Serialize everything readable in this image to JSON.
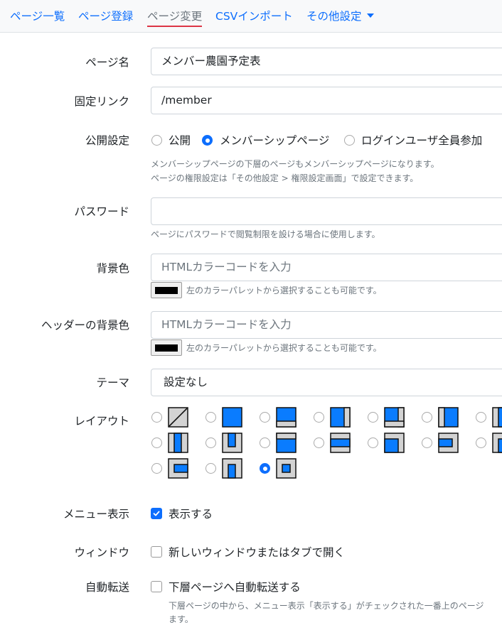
{
  "tabs": [
    {
      "label": "ページ一覧"
    },
    {
      "label": "ページ登録"
    },
    {
      "label": "ページ変更"
    },
    {
      "label": "CSVインポート"
    },
    {
      "label": "その他設定"
    }
  ],
  "form": {
    "page_name": {
      "label": "ページ名",
      "value": "メンバー農園予定表"
    },
    "permalink": {
      "label": "固定リンク",
      "value": "/member"
    },
    "visibility": {
      "label": "公開設定",
      "options": [
        "公開",
        "メンバーシップページ",
        "ログインユーザ全員参加"
      ],
      "selected": "メンバーシップページ",
      "help_1": "メンバーシップページの下層のページもメンバーシップページになります。",
      "help_2": "ページの権限設定は「その他設定 > 権限設定画面」で設定できます。"
    },
    "password": {
      "label": "パスワード",
      "value": "",
      "help": "ページにパスワードで閲覧制限を設ける場合に使用します。"
    },
    "bg_color": {
      "label": "背景色",
      "placeholder": "HTMLカラーコードを入力",
      "swatch": "#000000",
      "help": "左のカラーパレットから選択することも可能です。"
    },
    "header_bg_color": {
      "label": "ヘッダーの背景色",
      "placeholder": "HTMLカラーコードを入力",
      "swatch": "#000000",
      "help": "左のカラーパレットから選択することも可能です。"
    },
    "theme": {
      "label": "テーマ",
      "value": "設定なし"
    },
    "layout": {
      "label": "レイアウト",
      "selected_index": 16
    },
    "menu_display": {
      "label": "メニュー表示",
      "checkbox_label": "表示する",
      "checked": true
    },
    "window": {
      "label": "ウィンドウ",
      "checkbox_label": "新しいウィンドウまたはタブで開く",
      "checked": false
    },
    "auto_redirect": {
      "label": "自動転送",
      "checkbox_label": "下層ページへ自動転送する",
      "checked": false,
      "help_1": "下層ページの中から、メニュー表示「表示する」がチェックされた一番上のページ",
      "help_2": "ます。"
    }
  },
  "colors": {
    "accent": "#0d6efd",
    "layout_fill": "#0a7cff",
    "layout_bg": "#d3d3d3",
    "active_tab_underline": "#dc3545"
  }
}
